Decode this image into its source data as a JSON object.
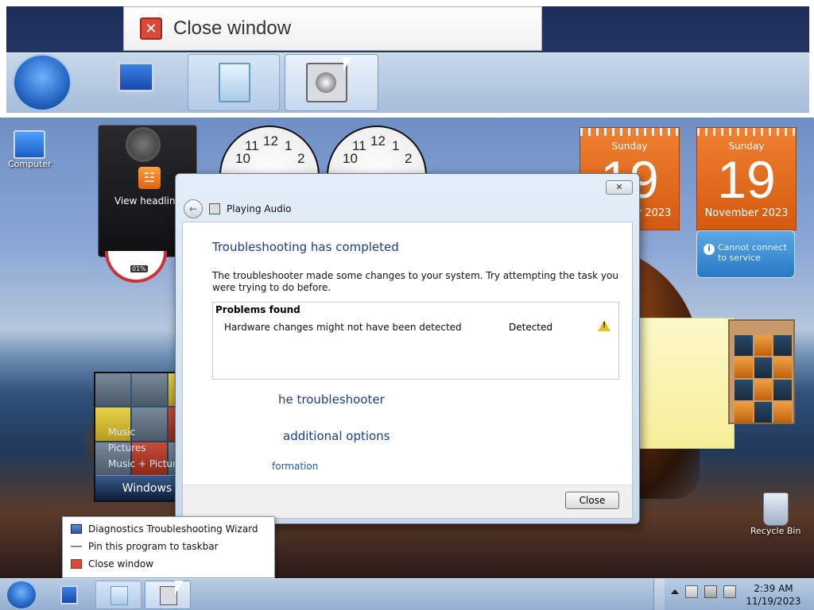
{
  "zoom_preview": {
    "menu_label": "Close window",
    "close_glyph": "✕"
  },
  "desktop": {
    "icons": [
      {
        "label": "Computer"
      },
      {
        "label": "Recycle Bin"
      }
    ]
  },
  "gadgets": {
    "feed": {
      "label": "View headlines",
      "rss_glyph": "☳"
    },
    "meter": {
      "percent": "01%"
    },
    "clock_numbers": [
      "12",
      "1",
      "2",
      "10",
      "11"
    ],
    "calendars": [
      {
        "dow": "Sunday",
        "day": "19",
        "month_year": "November 2023"
      },
      {
        "dow": "Sunday",
        "day": "19",
        "month_year": "November 2023"
      }
    ],
    "weather": {
      "message": "Cannot connect to service",
      "info_glyph": "i"
    },
    "media_center": {
      "menu": [
        "Music",
        "Pictures",
        "Music + Pictures"
      ],
      "title": "Windows Media Center"
    }
  },
  "dialog": {
    "close_glyph": "✕",
    "back_glyph": "←",
    "nav_title": "Playing Audio",
    "heading": "Troubleshooting has completed",
    "message": "The troubleshooter made some changes to your system. Try attempting the task you were trying to do before.",
    "problems": {
      "header": "Problems found",
      "rows": [
        {
          "problem": "Hardware changes might not have been detected",
          "status": "Detected",
          "icon": "warning-icon"
        }
      ]
    },
    "options": [
      "he troubleshooter",
      "additional options"
    ],
    "link": "formation",
    "close_button": "Close"
  },
  "jumplist": {
    "items": [
      {
        "label": "Diagnostics Troubleshooting Wizard",
        "icon": "wizard-icon"
      },
      {
        "label": "Pin this program to taskbar",
        "icon": "pin-icon"
      },
      {
        "label": "Close window",
        "icon": "close-icon"
      }
    ]
  },
  "taskbar": {
    "time": "2:39 AM",
    "date": "11/19/2023"
  }
}
